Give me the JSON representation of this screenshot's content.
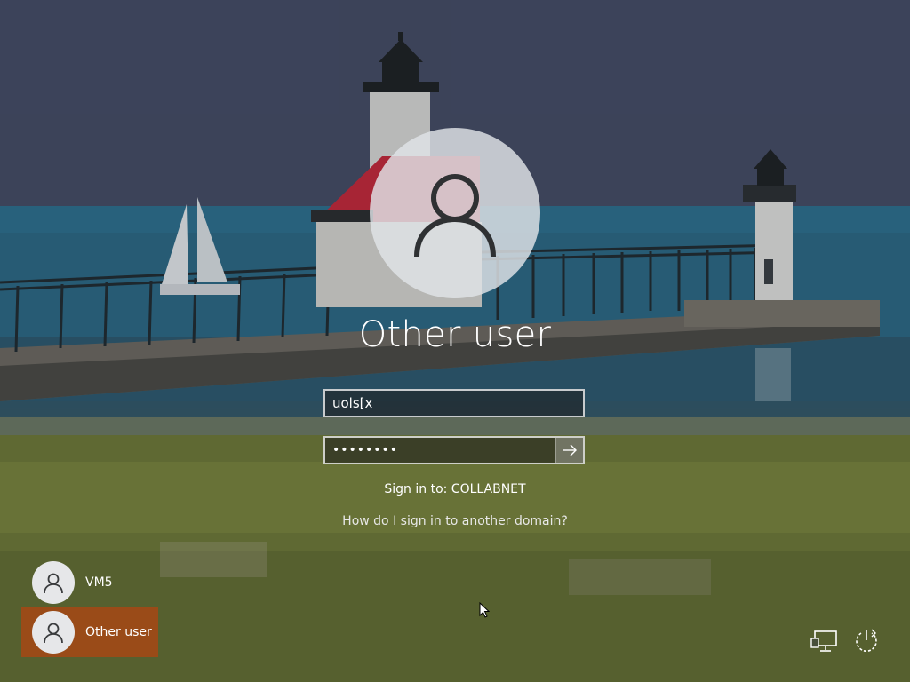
{
  "login": {
    "title": "Other user",
    "username_value": "uols[x",
    "password_mask": "••••••••",
    "sign_in_to": "Sign in to: COLLABNET",
    "other_domain_link": "How do I sign in to another domain?"
  },
  "users": [
    {
      "name": "VM5",
      "selected": false
    },
    {
      "name": "Other user",
      "selected": true
    }
  ],
  "icons": {
    "avatar": "person-icon",
    "submit": "arrow-right-icon",
    "network": "network-icon",
    "power": "power-icon"
  },
  "colors": {
    "selected_tile": "#a44816",
    "text": "#ffffff"
  }
}
